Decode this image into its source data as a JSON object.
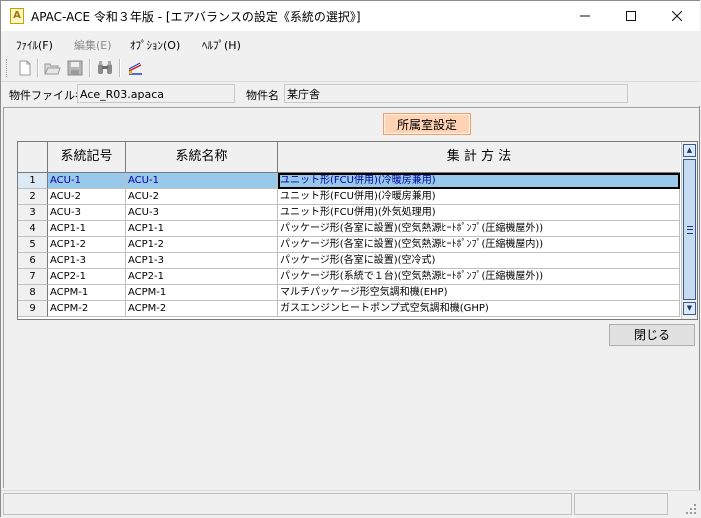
{
  "window": {
    "app_icon_glyph": "A",
    "title": "APAC-ACE 令和３年版 - [エアバランスの設定《系統の選択》]"
  },
  "menu": [
    {
      "label": "ﾌｧｲﾙ(F)",
      "enabled": true
    },
    {
      "label": "編集(E)",
      "enabled": false
    },
    {
      "label": "ｵﾌﾟｼｮﾝ(O)",
      "enabled": true
    },
    {
      "label": "ﾍﾙﾌﾟ(H)",
      "enabled": true
    }
  ],
  "toolbar": {
    "icons": [
      "new-file-icon",
      "open-folder-icon",
      "save-icon",
      "find-icon",
      "chart-icon"
    ]
  },
  "info": {
    "file_label": "物件ファイル名",
    "file_value": "Ace_R03.apaca",
    "project_label": "物件名",
    "project_value": "某庁舎"
  },
  "room_button": "所属室設定",
  "grid": {
    "headers": {
      "code": "系統記号",
      "name": "系統名称",
      "method": "集 計 方 法"
    },
    "rows": [
      {
        "no": "1",
        "code": "ACU-1",
        "name": "ACU-1",
        "method": "ユニット形(FCU併用)(冷暖房兼用)"
      },
      {
        "no": "2",
        "code": "ACU-2",
        "name": "ACU-2",
        "method": "ユニット形(FCU併用)(冷暖房兼用)"
      },
      {
        "no": "3",
        "code": "ACU-3",
        "name": "ACU-3",
        "method": "ユニット形(FCU併用)(外気処理用)"
      },
      {
        "no": "4",
        "code": "ACP1-1",
        "name": "ACP1-1",
        "method": "パッケージ形(各室に設置)(空気熱源ﾋｰﾄﾎﾟﾝﾌﾟ(圧縮機屋外))"
      },
      {
        "no": "5",
        "code": "ACP1-2",
        "name": "ACP1-2",
        "method": "パッケージ形(各室に設置)(空気熱源ﾋｰﾄﾎﾟﾝﾌﾟ(圧縮機屋内))"
      },
      {
        "no": "6",
        "code": "ACP1-3",
        "name": "ACP1-3",
        "method": "パッケージ形(各室に設置)(空冷式)"
      },
      {
        "no": "7",
        "code": "ACP2-1",
        "name": "ACP2-1",
        "method": "パッケージ形(系統で１台)(空気熱源ﾋｰﾄﾎﾟﾝﾌﾟ(圧縮機屋外))"
      },
      {
        "no": "8",
        "code": "ACPM-1",
        "name": "ACPM-1",
        "method": "マルチパッケージ形空気調和機(EHP)"
      },
      {
        "no": "9",
        "code": "ACPM-2",
        "name": "ACPM-2",
        "method": "ガスエンジンヒートポンプ式空気調和機(GHP)"
      }
    ],
    "selected_index": 0
  },
  "close_button": "閉じる",
  "colors": {
    "selection": "#99c9ea",
    "room_button_bg": "#ffd3b4",
    "scrollbar_thumb": "#c7dcf2"
  }
}
